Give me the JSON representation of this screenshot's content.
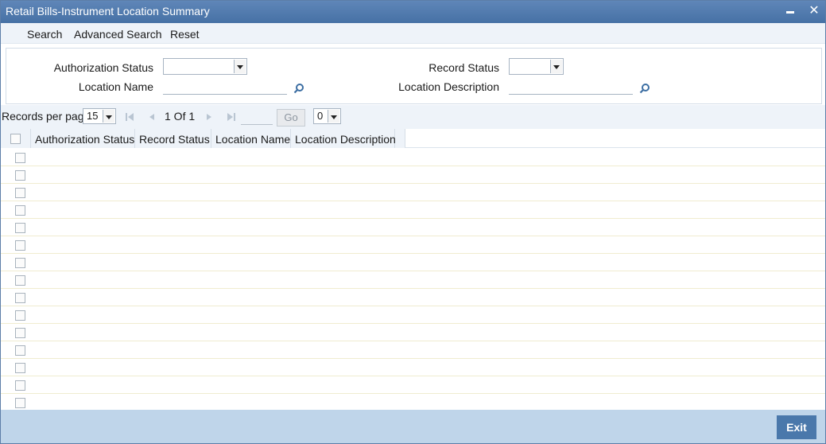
{
  "window": {
    "title": "Retail Bills-Instrument Location Summary"
  },
  "toolbar": {
    "search": "Search",
    "advanced_search": "Advanced Search",
    "reset": "Reset"
  },
  "search": {
    "authorization_status_label": "Authorization Status",
    "authorization_status_value": "",
    "record_status_label": "Record Status",
    "record_status_value": "",
    "location_name_label": "Location Name",
    "location_name_value": "",
    "location_description_label": "Location Description",
    "location_description_value": ""
  },
  "pager": {
    "records_per_page_label": "Records per page",
    "records_per_page_value": "15",
    "page_info": "1 Of 1",
    "goto_value": "",
    "go_label": "Go",
    "extra_select_value": "0"
  },
  "grid": {
    "columns": [
      "Authorization Status",
      "Record Status",
      "Location Name",
      "Location Description"
    ],
    "row_count": 15
  },
  "footer": {
    "exit_label": "Exit"
  },
  "icons": {
    "lookup": "magnifier-icon",
    "first": "first-page-icon",
    "prev": "prev-page-icon",
    "next": "next-page-icon",
    "last": "last-page-icon"
  }
}
